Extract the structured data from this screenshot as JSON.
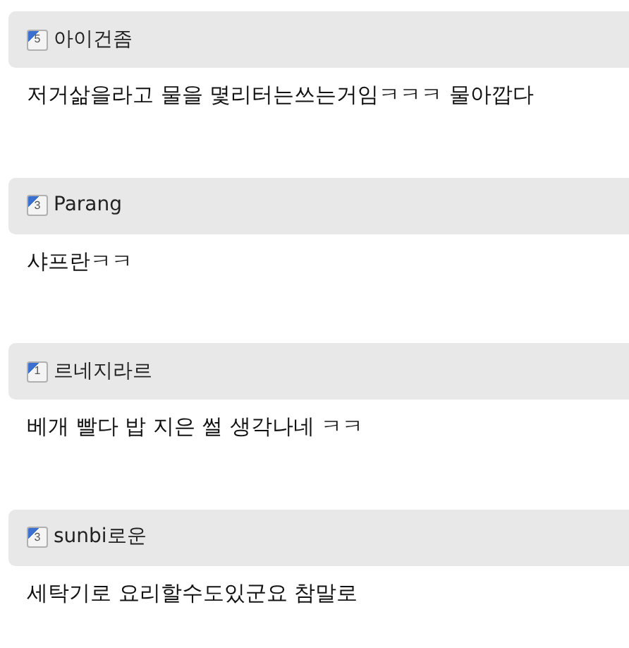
{
  "comments": [
    {
      "author": "아이건좀",
      "level_badge": "5",
      "text": "저거삶을라고 물을 몇리터는쓰는거임ㅋㅋㅋ 물아깝다"
    },
    {
      "author": "Parang",
      "level_badge": "3",
      "text": "샤프란ㅋㅋ"
    },
    {
      "author": "르네지라르",
      "level_badge": "1",
      "text": "베개 빨다 밥 지은 썰 생각나네 ㅋㅋ"
    },
    {
      "author": "sunbi로운",
      "level_badge": "3",
      "text": "세탁기로 요리할수도있군요 참말로"
    }
  ]
}
